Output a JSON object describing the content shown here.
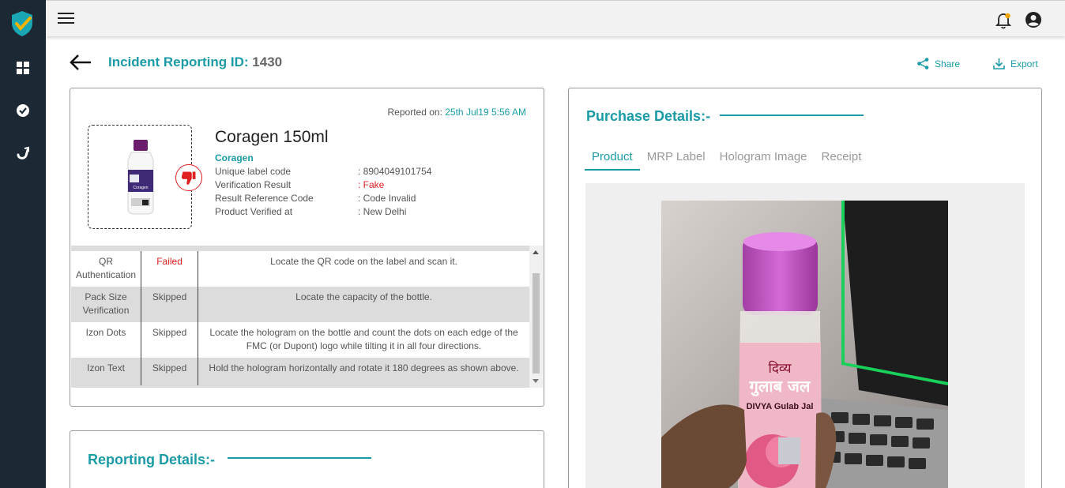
{
  "app": {
    "nav_icons": [
      "shield-logo-icon",
      "dashboard-icon",
      "check-circle-icon",
      "scan-icon"
    ]
  },
  "topbar": {
    "menu_icon": "hamburger-menu-icon",
    "notification_icon": "bell-icon",
    "account_icon": "account-circle-icon"
  },
  "header": {
    "title_label": "Incident Reporting ID",
    "title_separator": ":",
    "incident_id": "1430",
    "share_label": "Share",
    "export_label": "Export"
  },
  "product": {
    "reported_label": "Reported on:",
    "reported_date": "25th Jul19 5:56 AM",
    "name": "Coragen 150ml",
    "brand": "Coragen",
    "fields": [
      {
        "label": "Unique label code",
        "value": ": 8904049101754"
      },
      {
        "label": "Verification Result",
        "value": ": Fake"
      },
      {
        "label": "Result Reference Code",
        "value": ": Code Invalid"
      },
      {
        "label": "Product Verified at",
        "value": ": New Delhi"
      }
    ],
    "status_colors": {
      "fake": "#e02020",
      "accent": "#1a9ba5"
    }
  },
  "checks": [
    {
      "check": "QR Authentication",
      "status": "Failed",
      "instruction": "Locate the QR code on the label and scan it."
    },
    {
      "check": "Pack Size Verification",
      "status": "Skipped",
      "instruction": "Locate the capacity of the bottle."
    },
    {
      "check": "Izon Dots",
      "status": "Skipped",
      "instruction": "Locate the hologram on the bottle and count the dots on each edge of the FMC (or Dupont) logo while tilting it in all four directions."
    },
    {
      "check": "Izon Text",
      "status": "Skipped",
      "instruction": "Hold the hologram horizontally and rotate it 180 degrees as shown above."
    }
  ],
  "reporting": {
    "title": "Reporting Details:-"
  },
  "purchase": {
    "title": "Purchase Details:-",
    "tabs": [
      "Product",
      "MRP Label",
      "Hologram Image",
      "Receipt"
    ],
    "active_tab": "Product",
    "photo_label_hindi": "दिव्य",
    "photo_label_hindi2": "गुलाब जल",
    "photo_label_en": "DIVYA Gulab Jal"
  }
}
